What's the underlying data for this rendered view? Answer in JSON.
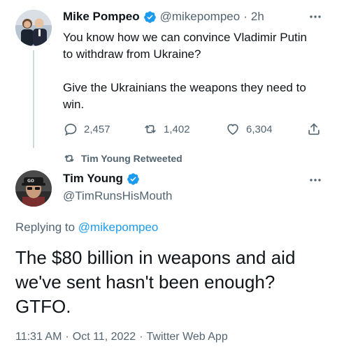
{
  "parent_tweet": {
    "author_name": "Mike Pompeo",
    "author_handle": "@mikepompeo",
    "separator": "·",
    "time_ago": "2h",
    "text_line1": "You know how we can convince Vladimir Putin",
    "text_line2": "to withdraw from Ukraine?",
    "text_line3": "Give the Ukrainians the weapons they need to",
    "text_line4": "win.",
    "replies": "2,457",
    "retweets": "1,402",
    "likes": "6,304",
    "icons": [
      "verified-badge-icon",
      "more-options-icon",
      "reply-icon",
      "retweet-icon",
      "like-icon",
      "share-icon"
    ]
  },
  "retweet_banner": {
    "text": "Tim Young Retweeted"
  },
  "main_tweet": {
    "author_name": "Tim Young",
    "author_handle": "@TimRunsHisMouth",
    "replying_prefix": "Replying to",
    "replying_handle": "@mikepompeo",
    "text_line1": "The $80 billion in weapons and aid",
    "text_line2": "we've sent hasn't been enough?",
    "text_line3": "GTFO.",
    "timestamp": "11:31 AM",
    "date": "Oct 11, 2022",
    "source": "Twitter Web App",
    "separator": "·"
  },
  "colors": {
    "accent": "#1d9bf0",
    "secondary_text": "#536471",
    "text": "#0f1419",
    "thread_line": "#cfd9de"
  }
}
